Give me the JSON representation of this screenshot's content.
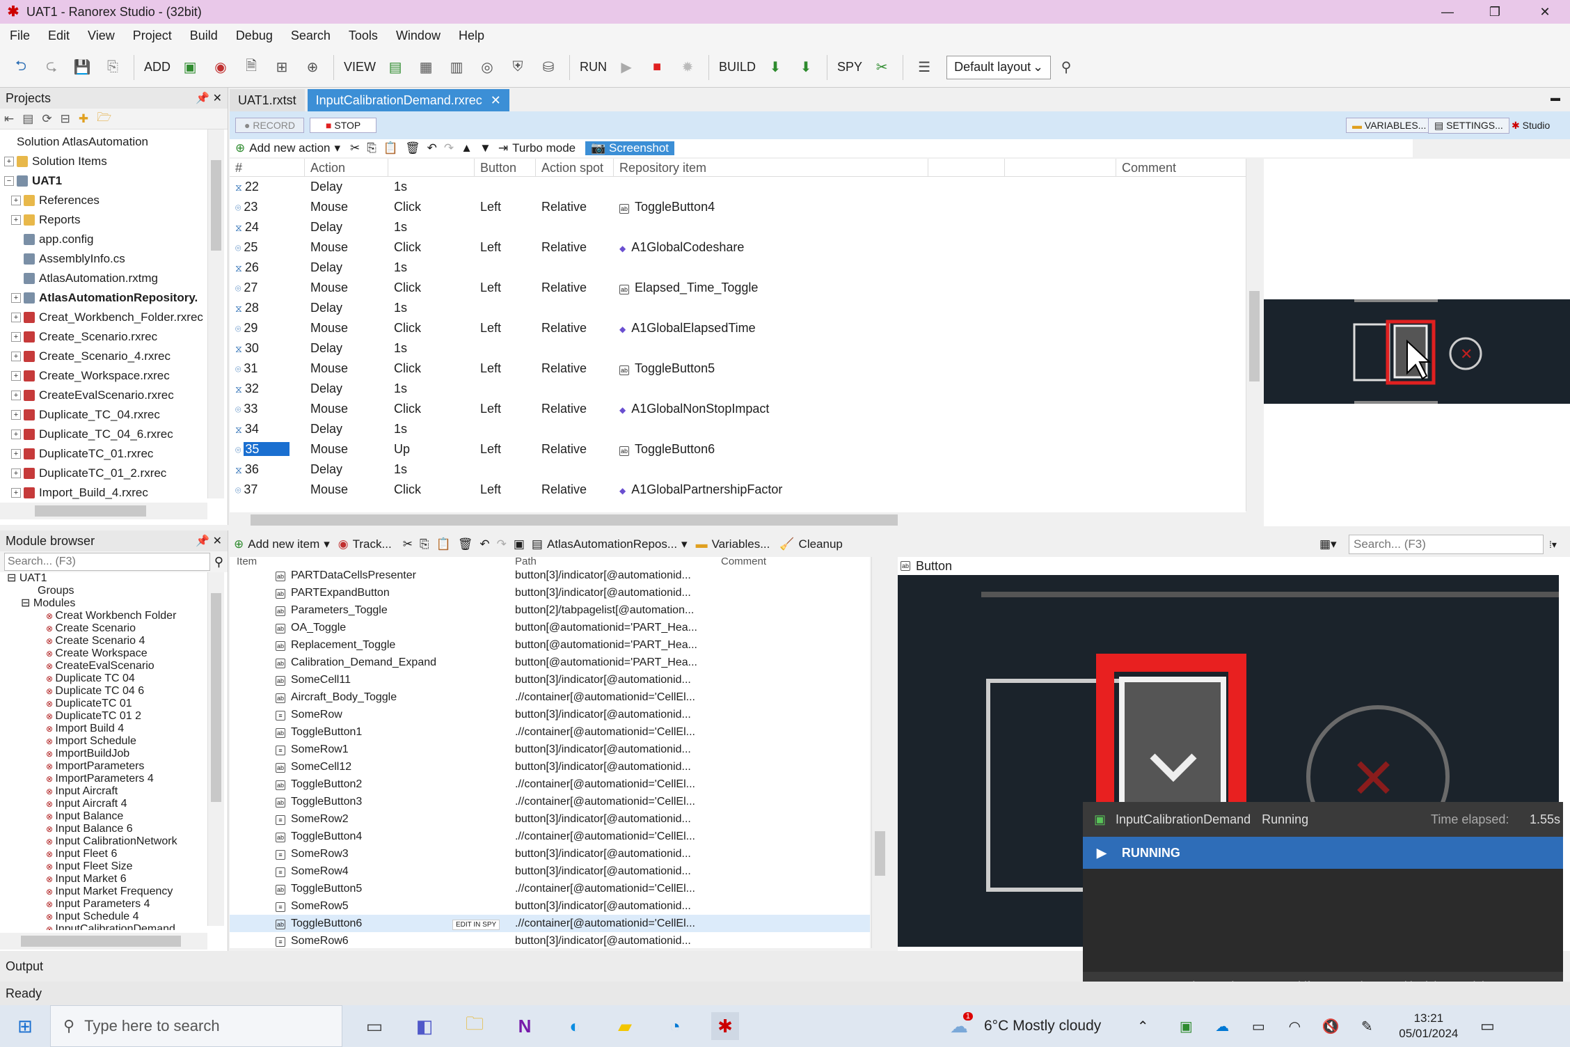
{
  "window": {
    "title": "UAT1 - Ranorex Studio - (32bit)",
    "minimize": "—",
    "maximize": "❐",
    "close": "✕"
  },
  "menu": [
    "File",
    "Edit",
    "View",
    "Project",
    "Build",
    "Debug",
    "Search",
    "Tools",
    "Window",
    "Help"
  ],
  "toolbar": {
    "add": "ADD",
    "view": "VIEW",
    "run": "RUN",
    "build": "BUILD",
    "spy": "SPY",
    "layout": "Default layout"
  },
  "projects": {
    "title": "Projects",
    "items": [
      {
        "label": "Solution AtlasAutomation",
        "indent": 0,
        "bold": false
      },
      {
        "label": "Solution Items",
        "indent": 0,
        "bold": false
      },
      {
        "label": "UAT1",
        "indent": 0,
        "bold": true
      },
      {
        "label": "References",
        "indent": 1,
        "bold": false
      },
      {
        "label": "Reports",
        "indent": 1,
        "bold": false
      },
      {
        "label": "app.config",
        "indent": 1,
        "bold": false
      },
      {
        "label": "AssemblyInfo.cs",
        "indent": 1,
        "bold": false
      },
      {
        "label": "AtlasAutomation.rxtmg",
        "indent": 1,
        "bold": false
      },
      {
        "label": "AtlasAutomationRepository.",
        "indent": 1,
        "bold": true
      },
      {
        "label": "Creat_Workbench_Folder.rxrec",
        "indent": 1,
        "bold": false
      },
      {
        "label": "Create_Scenario.rxrec",
        "indent": 1,
        "bold": false
      },
      {
        "label": "Create_Scenario_4.rxrec",
        "indent": 1,
        "bold": false
      },
      {
        "label": "Create_Workspace.rxrec",
        "indent": 1,
        "bold": false
      },
      {
        "label": "CreateEvalScenario.rxrec",
        "indent": 1,
        "bold": false
      },
      {
        "label": "Duplicate_TC_04.rxrec",
        "indent": 1,
        "bold": false
      },
      {
        "label": "Duplicate_TC_04_6.rxrec",
        "indent": 1,
        "bold": false
      },
      {
        "label": "DuplicateTC_01.rxrec",
        "indent": 1,
        "bold": false
      },
      {
        "label": "DuplicateTC_01_2.rxrec",
        "indent": 1,
        "bold": false
      },
      {
        "label": "Import_Build_4.rxrec",
        "indent": 1,
        "bold": false
      }
    ]
  },
  "module_browser": {
    "title": "Module browser",
    "search_placeholder": "Search... (F3)",
    "root": "UAT1",
    "groups": "Groups",
    "modules_label": "Modules",
    "modules": [
      "Creat Workbench Folder",
      "Create Scenario",
      "Create Scenario 4",
      "Create Workspace",
      "CreateEvalScenario",
      "Duplicate TC 04",
      "Duplicate TC 04 6",
      "DuplicateTC 01",
      "DuplicateTC 01 2",
      "Import Build 4",
      "Import Schedule",
      "ImportBuildJob",
      "ImportParameters",
      "ImportParameters 4",
      "Input Aircraft",
      "Input Aircraft 4",
      "Input Balance",
      "Input Balance 6",
      "Input CalibrationNetwork",
      "Input Fleet 6",
      "Input Fleet Size",
      "Input Market 6",
      "Input Market Frequency",
      "Input Parameters 4",
      "Input Schedule 4",
      "InputCalibrationDemand"
    ]
  },
  "tabs": [
    {
      "label": "UAT1.rxtst",
      "active": false
    },
    {
      "label": "InputCalibrationDemand.rxrec",
      "active": true
    }
  ],
  "recorder": {
    "record": "RECORD",
    "stop": "STOP",
    "variables": "VARIABLES...",
    "settings": "SETTINGS...",
    "studio": "Studio",
    "add_action": "Add new action",
    "turbo": "Turbo mode",
    "screenshot": "Screenshot"
  },
  "actions_columns": [
    "#",
    "Action",
    "",
    "Button",
    "Action spot",
    "Repository item",
    "",
    "",
    "Comment"
  ],
  "actions": [
    {
      "n": "22",
      "type": "delay",
      "action": "Delay",
      "detail": "1s",
      "button": "",
      "spot": "",
      "item": "",
      "ic": ""
    },
    {
      "n": "23",
      "type": "mouse",
      "action": "Mouse",
      "detail": "Click",
      "button": "Left",
      "spot": "Relative",
      "item": "ToggleButton4",
      "ic": "btn"
    },
    {
      "n": "24",
      "type": "delay",
      "action": "Delay",
      "detail": "1s",
      "button": "",
      "spot": "",
      "item": "",
      "ic": ""
    },
    {
      "n": "25",
      "type": "mouse",
      "action": "Mouse",
      "detail": "Click",
      "button": "Left",
      "spot": "Relative",
      "item": "A1GlobalCodeshare",
      "ic": "gem"
    },
    {
      "n": "26",
      "type": "delay",
      "action": "Delay",
      "detail": "1s",
      "button": "",
      "spot": "",
      "item": "",
      "ic": ""
    },
    {
      "n": "27",
      "type": "mouse",
      "action": "Mouse",
      "detail": "Click",
      "button": "Left",
      "spot": "Relative",
      "item": "Elapsed_Time_Toggle",
      "ic": "btn"
    },
    {
      "n": "28",
      "type": "delay",
      "action": "Delay",
      "detail": "1s",
      "button": "",
      "spot": "",
      "item": "",
      "ic": ""
    },
    {
      "n": "29",
      "type": "mouse",
      "action": "Mouse",
      "detail": "Click",
      "button": "Left",
      "spot": "Relative",
      "item": "A1GlobalElapsedTime",
      "ic": "gem"
    },
    {
      "n": "30",
      "type": "delay",
      "action": "Delay",
      "detail": "1s",
      "button": "",
      "spot": "",
      "item": "",
      "ic": ""
    },
    {
      "n": "31",
      "type": "mouse",
      "action": "Mouse",
      "detail": "Click",
      "button": "Left",
      "spot": "Relative",
      "item": "ToggleButton5",
      "ic": "btn"
    },
    {
      "n": "32",
      "type": "delay",
      "action": "Delay",
      "detail": "1s",
      "button": "",
      "spot": "",
      "item": "",
      "ic": ""
    },
    {
      "n": "33",
      "type": "mouse",
      "action": "Mouse",
      "detail": "Click",
      "button": "Left",
      "spot": "Relative",
      "item": "A1GlobalNonStopImpact",
      "ic": "gem"
    },
    {
      "n": "34",
      "type": "delay",
      "action": "Delay",
      "detail": "1s",
      "button": "",
      "spot": "",
      "item": "",
      "ic": ""
    },
    {
      "n": "35",
      "type": "mouse",
      "action": "Mouse",
      "detail": "Up",
      "button": "Left",
      "spot": "Relative",
      "item": "ToggleButton6",
      "ic": "btn",
      "selected": true
    },
    {
      "n": "36",
      "type": "delay",
      "action": "Delay",
      "detail": "1s",
      "button": "",
      "spot": "",
      "item": "",
      "ic": ""
    },
    {
      "n": "37",
      "type": "mouse",
      "action": "Mouse",
      "detail": "Click",
      "button": "Left",
      "spot": "Relative",
      "item": "A1GlobalPartnershipFactor",
      "ic": "gem"
    }
  ],
  "repo": {
    "add_item": "Add new item",
    "track": "Track...",
    "repo_name": "AtlasAutomationRepos...",
    "variables": "Variables...",
    "cleanup": "Cleanup",
    "search_placeholder": "Search... (F3)",
    "columns": [
      "Item",
      "Path",
      "Comment"
    ],
    "edit_in_spy": "EDIT IN SPY",
    "rows": [
      {
        "item": "PARTDataCellsPresenter",
        "path": "button[3]/indicator[@automationid..."
      },
      {
        "item": "PARTExpandButton",
        "path": "button[3]/indicator[@automationid..."
      },
      {
        "item": "Parameters_Toggle",
        "path": "button[2]/tabpagelist[@automation..."
      },
      {
        "item": "OA_Toggle",
        "path": "button[@automationid='PART_Hea..."
      },
      {
        "item": "Replacement_Toggle",
        "path": "button[@automationid='PART_Hea..."
      },
      {
        "item": "Calibration_Demand_Expand",
        "path": "button[@automationid='PART_Hea..."
      },
      {
        "item": "SomeCell11",
        "path": "button[3]/indicator[@automationid..."
      },
      {
        "item": "Aircraft_Body_Toggle",
        "path": ".//container[@automationid='CellEl..."
      },
      {
        "item": "SomeRow",
        "path": "button[3]/indicator[@automationid..."
      },
      {
        "item": "ToggleButton1",
        "path": ".//container[@automationid='CellEl..."
      },
      {
        "item": "SomeRow1",
        "path": "button[3]/indicator[@automationid..."
      },
      {
        "item": "SomeCell12",
        "path": "button[3]/indicator[@automationid..."
      },
      {
        "item": "ToggleButton2",
        "path": ".//container[@automationid='CellEl..."
      },
      {
        "item": "ToggleButton3",
        "path": ".//container[@automationid='CellEl..."
      },
      {
        "item": "SomeRow2",
        "path": "button[3]/indicator[@automationid..."
      },
      {
        "item": "ToggleButton4",
        "path": ".//container[@automationid='CellEl..."
      },
      {
        "item": "SomeRow3",
        "path": "button[3]/indicator[@automationid..."
      },
      {
        "item": "SomeRow4",
        "path": "button[3]/indicator[@automationid..."
      },
      {
        "item": "ToggleButton5",
        "path": ".//container[@automationid='CellEl..."
      },
      {
        "item": "SomeRow5",
        "path": "button[3]/indicator[@automationid..."
      },
      {
        "item": "ToggleButton6",
        "path": ".//container[@automationid='CellEl...",
        "selected": true
      },
      {
        "item": "SomeRow6",
        "path": "button[3]/indicator[@automationid..."
      }
    ]
  },
  "preview": {
    "title": "Button"
  },
  "runner": {
    "name": "InputCalibrationDemand",
    "state": "Running",
    "elapsed_label": "Time elapsed:",
    "elapsed": "1.55s",
    "status": "RUNNING",
    "hint": "Press 'Pause' key to abort. Press 'Shift'+'Pause' keys to skip delays and timeouts."
  },
  "output": {
    "title": "Output"
  },
  "status": {
    "text": "Ready"
  },
  "taskbar": {
    "search_placeholder": "Type here to search",
    "weather": "6°C  Mostly cloudy",
    "weather_badge": "1",
    "time": "13:21",
    "date": "05/01/2024"
  }
}
